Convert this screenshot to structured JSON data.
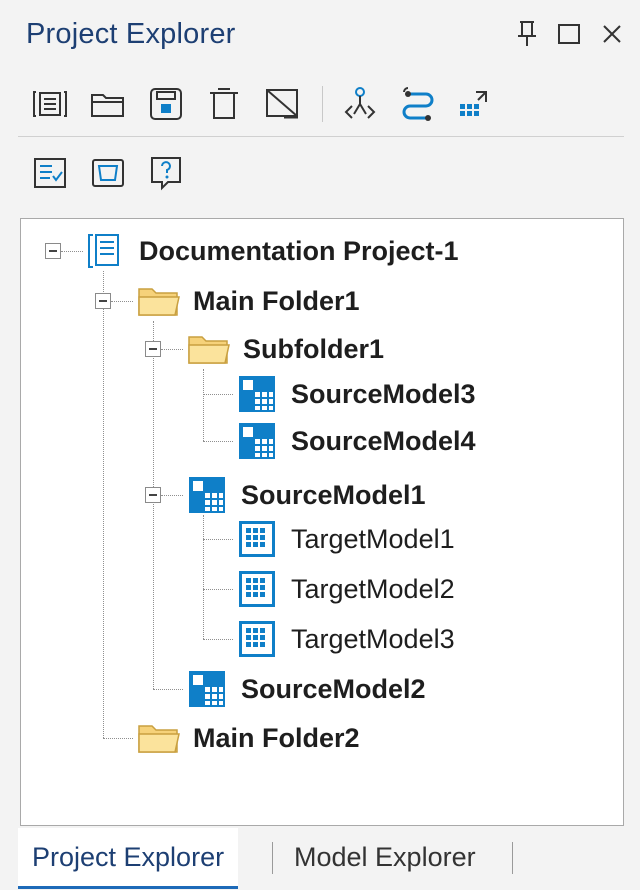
{
  "panel": {
    "title": "Project Explorer"
  },
  "window_controls": {
    "pin": "pin-icon",
    "maximize": "maximize-icon",
    "close": "close-icon"
  },
  "toolbar": {
    "row1": [
      "properties-icon",
      "open-folder-icon",
      "save-icon",
      "delete-icon",
      "close-model-icon",
      "model-mapping-icon",
      "link-icon",
      "expand-icon"
    ],
    "row2": [
      "checklist-icon",
      "window-icon",
      "help-icon"
    ]
  },
  "tree": {
    "root": {
      "label": "Documentation Project-1",
      "icon": "project-icon"
    },
    "main_folder1": {
      "label": "Main Folder1",
      "icon": "folder-icon"
    },
    "subfolder1": {
      "label": "Subfolder1",
      "icon": "folder-icon"
    },
    "source_model3": {
      "label": "SourceModel3",
      "icon": "source-model-icon"
    },
    "source_model4": {
      "label": "SourceModel4",
      "icon": "source-model-icon"
    },
    "source_model1": {
      "label": "SourceModel1",
      "icon": "source-model-icon"
    },
    "target_model1": {
      "label": "TargetModel1",
      "icon": "target-model-icon"
    },
    "target_model2": {
      "label": "TargetModel2",
      "icon": "target-model-icon"
    },
    "target_model3": {
      "label": "TargetModel3",
      "icon": "target-model-icon"
    },
    "source_model2": {
      "label": "SourceModel2",
      "icon": "source-model-icon"
    },
    "main_folder2": {
      "label": "Main Folder2",
      "icon": "folder-icon"
    }
  },
  "tabs": [
    {
      "label": "Project Explorer",
      "active": true
    },
    {
      "label": "Model Explorer",
      "active": false
    }
  ],
  "colors": {
    "accent_blue": "#1d6ab8",
    "icon_blue": "#0f7fc8",
    "folder_yellow": "#f6d27a",
    "title_blue": "#1d3f73"
  }
}
